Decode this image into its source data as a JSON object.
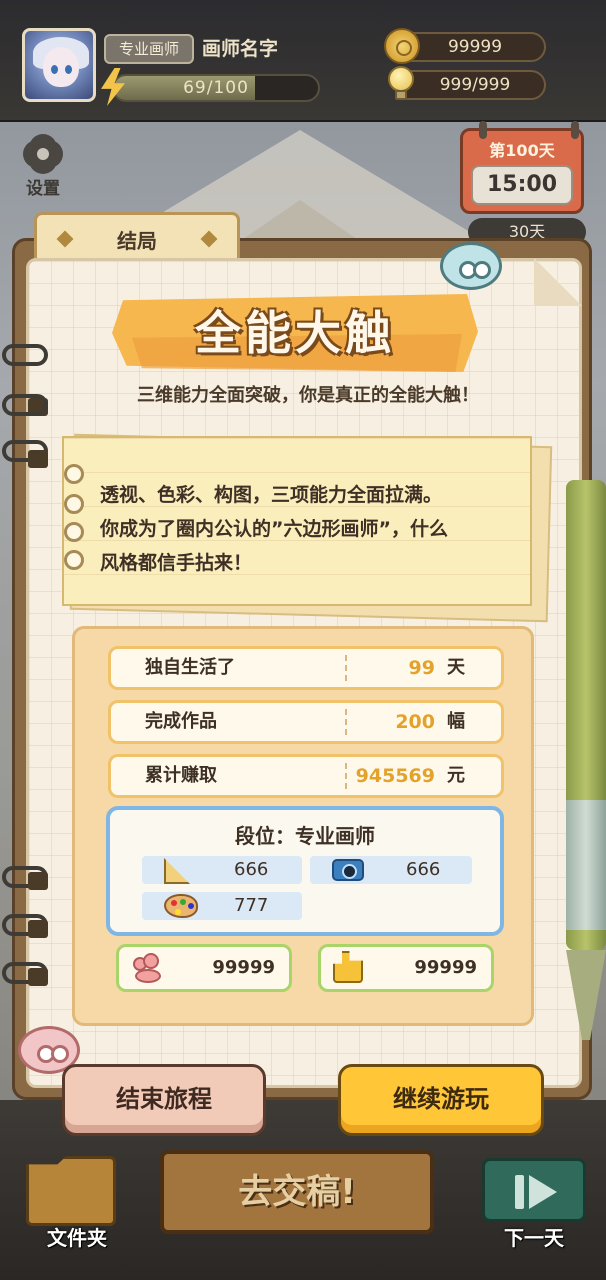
{
  "player": {
    "rank": "专业画师",
    "name": "画师名字",
    "energy_text": "69/100",
    "energy_fraction": 0.69
  },
  "resources": {
    "coins": "99999",
    "bulbs": "999/999"
  },
  "settings_label": "设置",
  "calendar": {
    "day": "第100天",
    "time": "15:00",
    "countdown": "30天"
  },
  "tab_label": "结局",
  "ending": {
    "title": "全能大触",
    "subtitle": "三维能力全面突破，你是真正的全能大触！",
    "description_lines": [
      "透视、色彩、构图，三项能力全面拉满。",
      "你成为了圈内公认的”六边形画师”，什么",
      "风格都信手拈来！"
    ]
  },
  "stats": [
    {
      "label": "独自生活了",
      "value": "99",
      "unit": "天"
    },
    {
      "label": "完成作品",
      "value": "200",
      "unit": "幅"
    },
    {
      "label": "累计赚取",
      "value": "945569",
      "unit": "元"
    }
  ],
  "rank_box": {
    "title": "段位：专业画师",
    "perspective": "666",
    "composition": "666",
    "color": "777"
  },
  "social": {
    "fans": "99999",
    "likes": "99999"
  },
  "buttons": {
    "end": "结束旅程",
    "continue": "继续游玩"
  },
  "bottom_bar": {
    "folder": "文件夹",
    "submit": "去交稿!",
    "next_day": "下一天"
  },
  "colors": {
    "accent_orange": "#f6b74f",
    "value_gold": "#e3a22a",
    "continue_button": "#ffc637",
    "end_button": "#f2cab8",
    "rank_border": "#7fb6e6"
  }
}
